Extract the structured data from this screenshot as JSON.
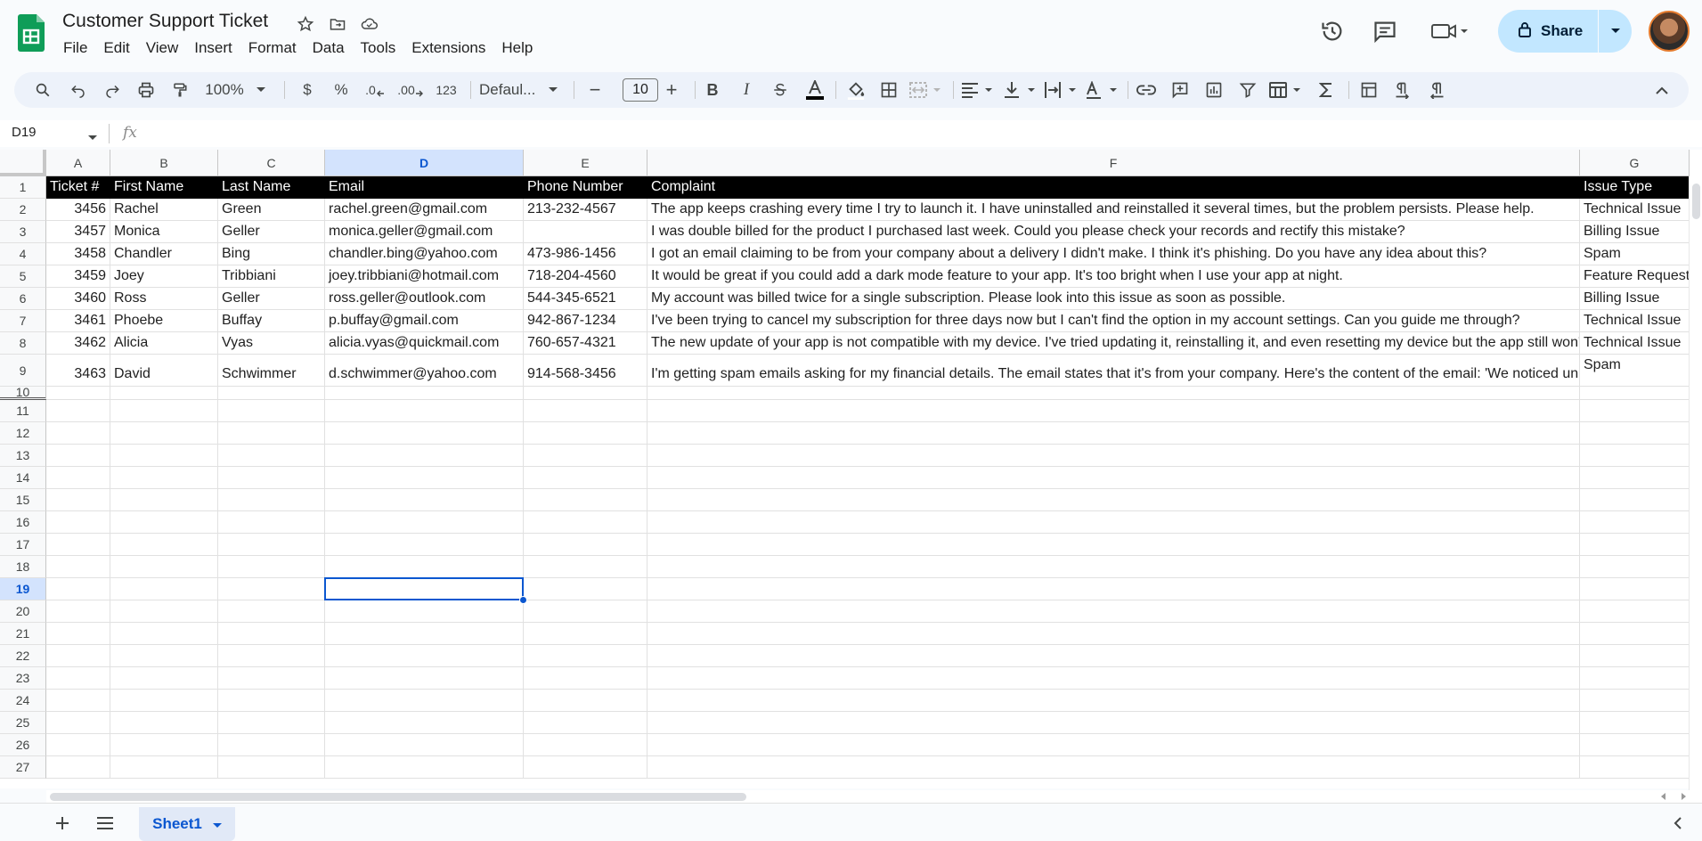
{
  "app": {
    "title": "Customer Support Ticket"
  },
  "menu": [
    "File",
    "Edit",
    "View",
    "Insert",
    "Format",
    "Data",
    "Tools",
    "Extensions",
    "Help"
  ],
  "header_actions": {
    "share_label": "Share"
  },
  "toolbar": {
    "zoom": "100%",
    "currency": "$",
    "percent": "%",
    "dec_decrease": ".0",
    "dec_increase": ".00",
    "number_format": "123",
    "font": "Defaul...",
    "font_size": "10",
    "minus": "−",
    "plus": "+",
    "bold": "B",
    "italic": "I"
  },
  "formula_bar": {
    "cell_ref": "D19",
    "fx": "fx",
    "value": ""
  },
  "grid": {
    "columns": [
      "A",
      "B",
      "C",
      "D",
      "E",
      "F",
      "G"
    ],
    "selected_column": "D",
    "selected_row": "19",
    "rows": [
      "1",
      "2",
      "3",
      "4",
      "5",
      "6",
      "7",
      "8",
      "9",
      "10",
      "11",
      "12",
      "13",
      "14",
      "15",
      "16",
      "17",
      "18",
      "19",
      "20",
      "21",
      "22",
      "23",
      "24",
      "25",
      "26",
      "27"
    ],
    "headers": [
      "Ticket #",
      "First Name",
      "Last Name",
      "Email",
      "Phone Number",
      "Complaint",
      "Issue Type"
    ],
    "data": [
      [
        "3456",
        "Rachel",
        "Green",
        "rachel.green@gmail.com",
        "213-232-4567",
        "The app keeps crashing every time I try to launch it. I have uninstalled and reinstalled it several times, but the problem persists. Please help.",
        "Technical Issue"
      ],
      [
        "3457",
        "Monica",
        "Geller",
        "monica.geller@gmail.com",
        "",
        "I was double billed for the product I purchased last week. Could you please check your records and rectify this mistake?",
        "Billing Issue"
      ],
      [
        "3458",
        "Chandler",
        "Bing",
        "chandler.bing@yahoo.com",
        "473-986-1456",
        "I got an email claiming to be from your company about a delivery I didn't make. I think it's phishing. Do you have any idea about this?",
        "Spam"
      ],
      [
        "3459",
        "Joey",
        "Tribbiani",
        "joey.tribbiani@hotmail.com",
        "718-204-4560",
        "It would be great if you could add a dark mode feature to your app. It's too bright when I use your app at night.",
        "Feature Request"
      ],
      [
        "3460",
        "Ross",
        "Geller",
        "ross.geller@outlook.com",
        "544-345-6521",
        "My account was billed twice for a single subscription. Please look into this issue as soon as possible.",
        "Billing Issue"
      ],
      [
        "3461",
        "Phoebe",
        "Buffay",
        "p.buffay@gmail.com",
        "942-867-1234",
        "I've been trying to cancel my subscription for three days now but I can't find the option in my account settings. Can you guide me through?",
        "Technical Issue"
      ],
      [
        "3462",
        "Alicia",
        "Vyas",
        "alicia.vyas@quickmail.com",
        "760-657-4321",
        "The new update of your app is not compatible with my device. I've tried updating it, reinstalling it, and even resetting my device but the app still won't",
        "Technical Issue"
      ],
      [
        "3463",
        "David",
        "Schwimmer",
        "d.schwimmer@yahoo.com",
        "914-568-3456",
        "I'm getting spam emails asking for my financial details. The email states that it's from your company. Here's the content of the email: 'We noticed unu",
        "Spam"
      ]
    ]
  },
  "sheets": {
    "active": "Sheet1"
  }
}
